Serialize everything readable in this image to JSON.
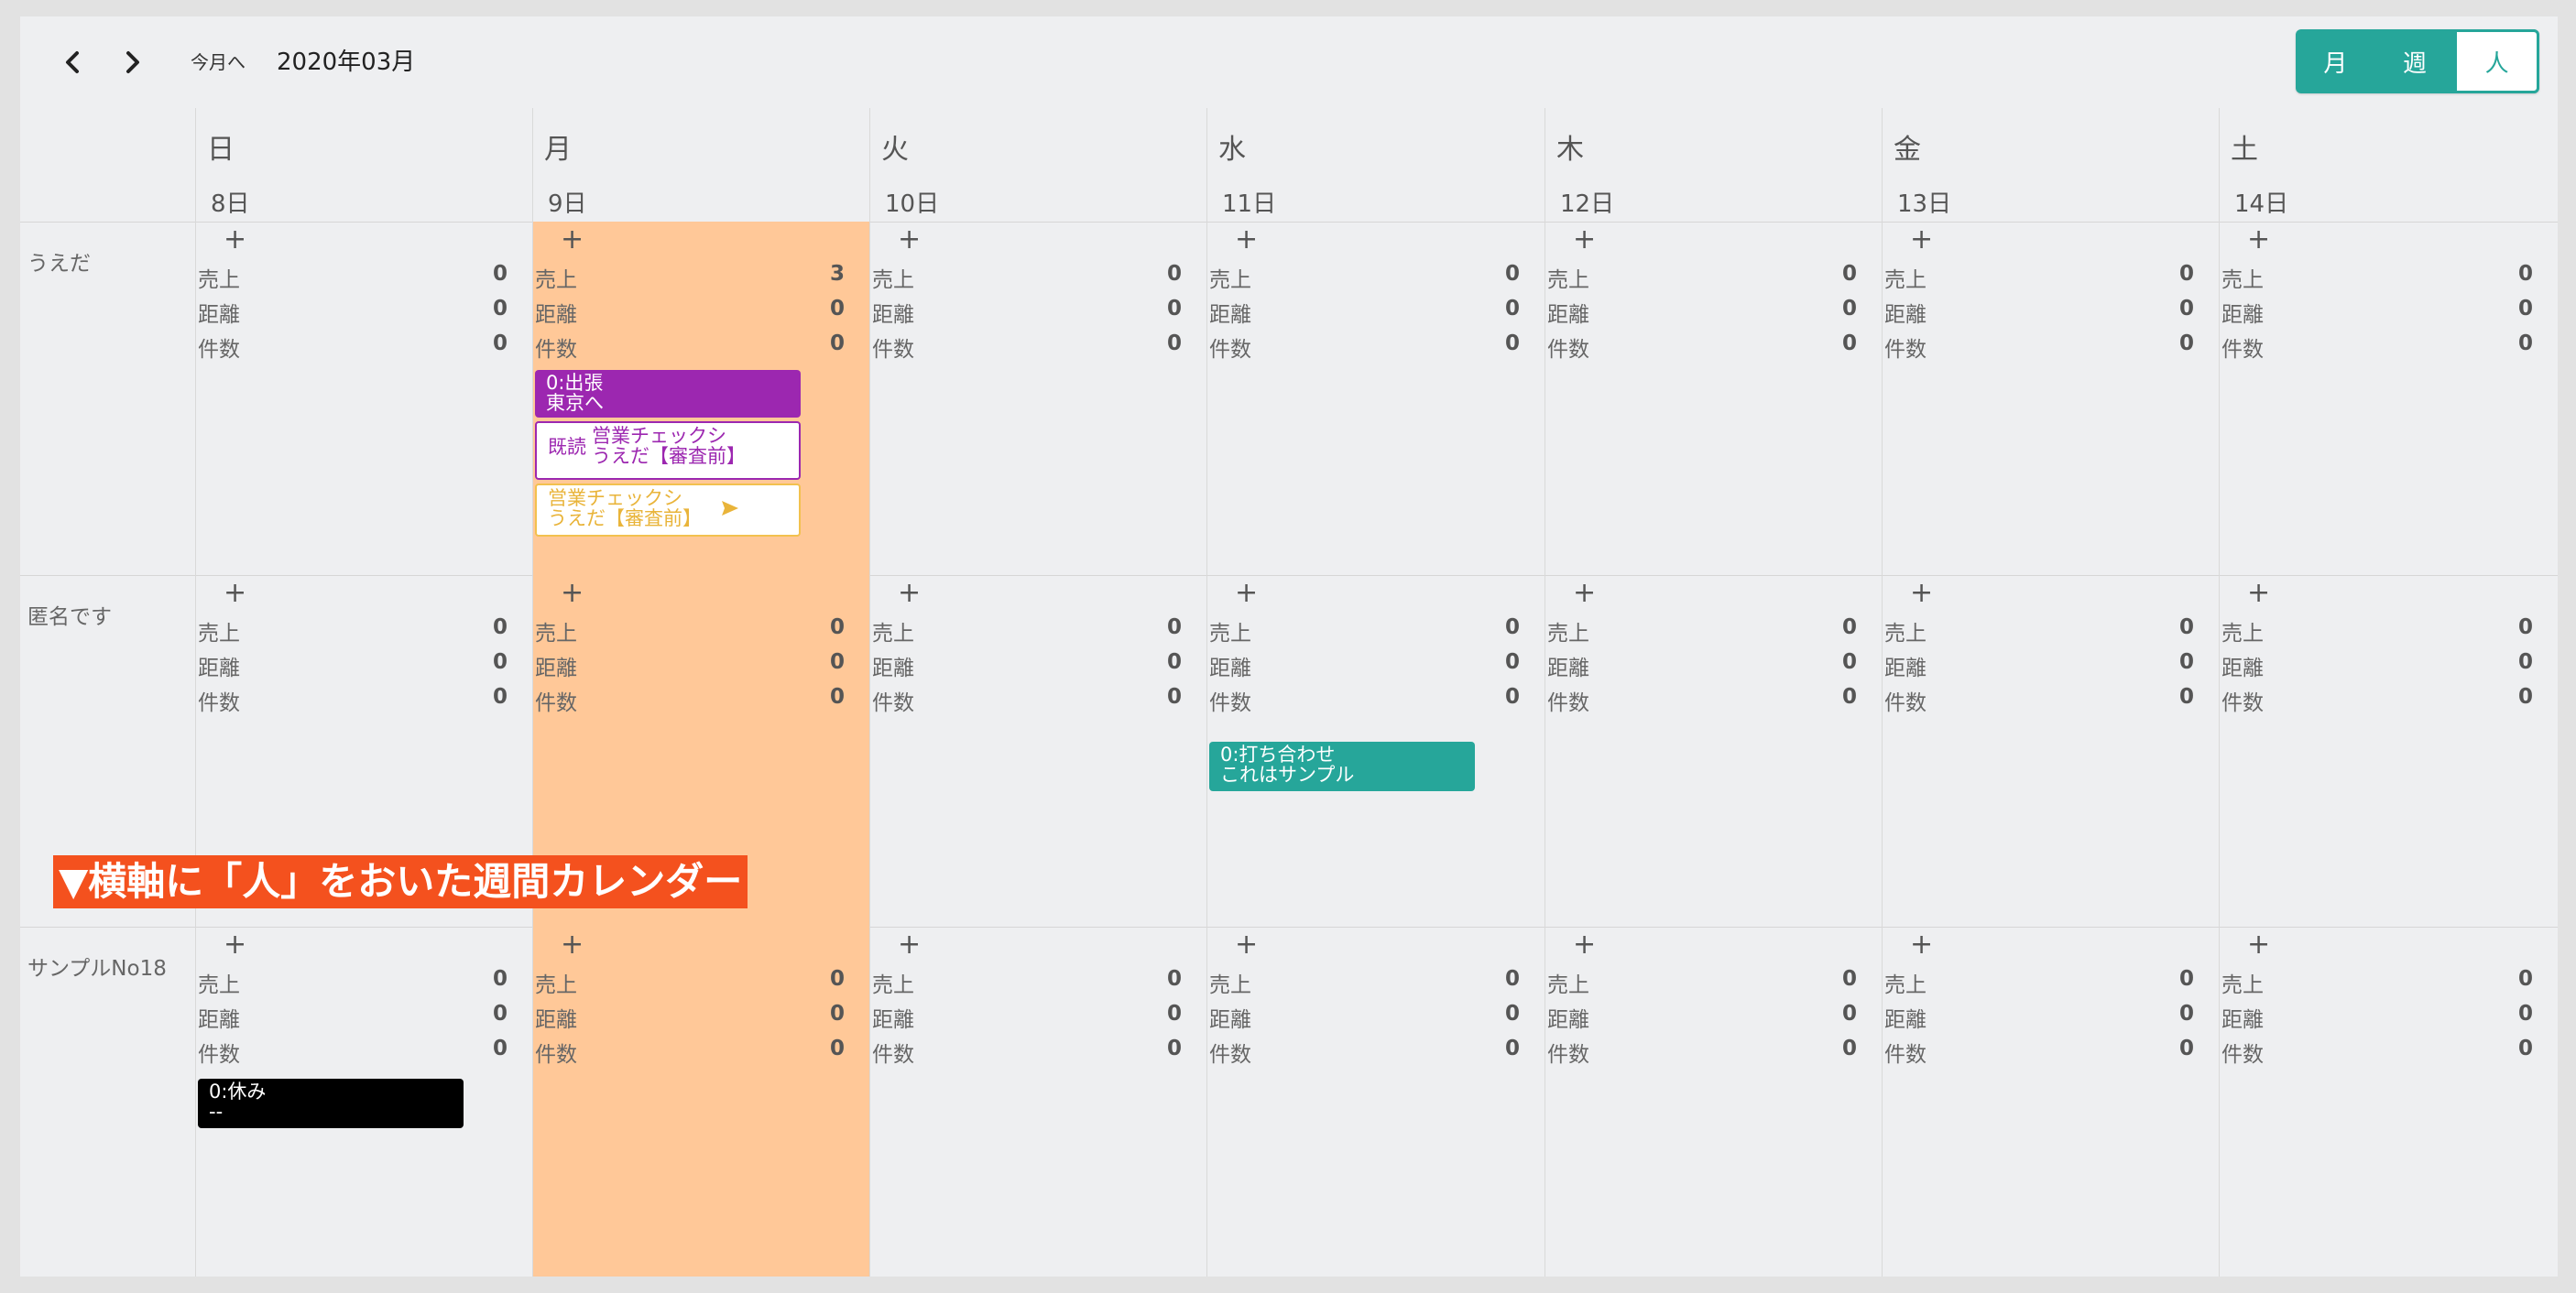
{
  "toolbar": {
    "today_label": "今月へ",
    "month_label": "2020年03月",
    "views": [
      "月",
      "週",
      "人"
    ],
    "active_view": "人"
  },
  "days": [
    {
      "dow": "日",
      "date": "8日"
    },
    {
      "dow": "月",
      "date": "9日"
    },
    {
      "dow": "火",
      "date": "10日"
    },
    {
      "dow": "水",
      "date": "11日"
    },
    {
      "dow": "木",
      "date": "12日"
    },
    {
      "dow": "金",
      "date": "13日"
    },
    {
      "dow": "土",
      "date": "14日"
    }
  ],
  "metric_labels": [
    "売上",
    "距離",
    "件数"
  ],
  "add_symbol": "+",
  "people": [
    {
      "name": "うえだ",
      "metrics": [
        [
          0,
          0,
          0
        ],
        [
          3,
          0,
          0
        ],
        [
          0,
          0,
          0
        ],
        [
          0,
          0,
          0
        ],
        [
          0,
          0,
          0
        ],
        [
          0,
          0,
          0
        ],
        [
          0,
          0,
          0
        ]
      ]
    },
    {
      "name": "匿名です",
      "metrics": [
        [
          0,
          0,
          0
        ],
        [
          0,
          0,
          0
        ],
        [
          0,
          0,
          0
        ],
        [
          0,
          0,
          0
        ],
        [
          0,
          0,
          0
        ],
        [
          0,
          0,
          0
        ],
        [
          0,
          0,
          0
        ]
      ]
    },
    {
      "name": "サンプルNo18",
      "metrics": [
        [
          0,
          0,
          0
        ],
        [
          0,
          0,
          0
        ],
        [
          0,
          0,
          0
        ],
        [
          0,
          0,
          0
        ],
        [
          0,
          0,
          0
        ],
        [
          0,
          0,
          0
        ],
        [
          0,
          0,
          0
        ]
      ]
    }
  ],
  "events": {
    "ueda_mon_1": {
      "line1": "0:出張",
      "line2": "東京へ",
      "color": "#9c27b0"
    },
    "ueda_mon_2": {
      "tag": "既読",
      "line1": "営業チェックシ",
      "line2": "うえだ【審査前】",
      "color": "#9c27b0"
    },
    "ueda_mon_3": {
      "line1": "営業チェックシ",
      "line2": "うえだ【審査前】",
      "color": "#f2c14e"
    },
    "anon_wed_1": {
      "line1": "0:打ち合わせ",
      "line2": "これはサンプル",
      "color": "#26a69a"
    },
    "sample_sun_1": {
      "line1": "0:休み",
      "line2": "--",
      "color": "#000000"
    }
  },
  "banner": "▼横軸に「人」をおいた週間カレンダー",
  "colors": {
    "accent": "#26a69a",
    "today_bg": "#ffc898",
    "banner_bg": "#f4511e"
  }
}
